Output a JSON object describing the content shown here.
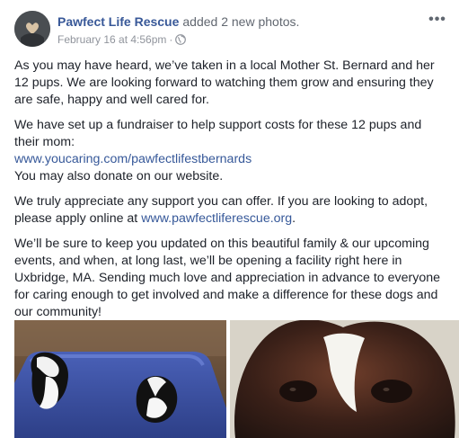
{
  "post": {
    "author": "Pawfect Life Rescue",
    "action": "added 2 new photos.",
    "timestamp": "February 16 at 4:56pm",
    "separator": "·",
    "privacy_icon": "globe-icon",
    "more_icon": "ellipsis-icon",
    "paragraphs": {
      "p1": "As you may have heard, we’ve taken in a local Mother St. Bernard and her 12 pups. We are looking forward to watching them grow and ensuring they are safe, happy and well cared for.",
      "p2_line1": "We have set up a fundraiser to help support costs for these 12 pups and their mom:",
      "p2_link": "www.youcaring.com/pawfectlifestbernards",
      "p2_line3": "You may also donate on our website.",
      "p3_text": "We truly appreciate any support you can offer. If you are looking to adopt, please apply online at ",
      "p3_link": "www.pawfectliferescue.org",
      "p3_end": ".",
      "p4": "We’ll be sure to keep you updated on this beautiful family & our upcoming events, and when, at long last, we’ll be opening a facility right here in Uxbridge, MA. Sending much love and appreciation in advance to everyone for caring enough to get involved and make a difference for these dogs and our community!"
    }
  },
  "colors": {
    "author_link": "#385898",
    "text": "#1d2129",
    "meta": "#90949c",
    "link": "#365899"
  }
}
